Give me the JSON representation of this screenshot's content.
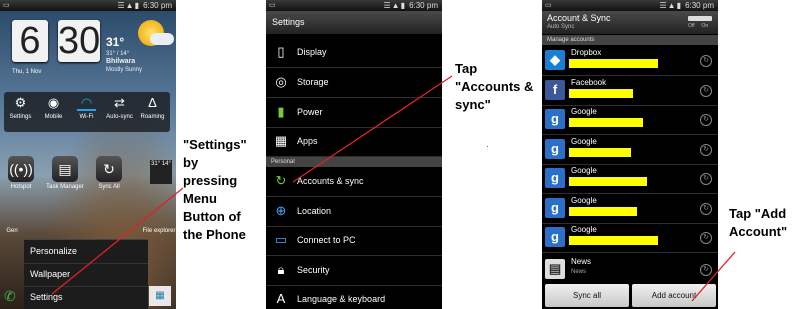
{
  "status_time": "6:30",
  "status_time_suffix": "pm",
  "phone1": {
    "clock_hour": "6",
    "clock_minute": "30",
    "temperature": "31°",
    "temp_range": "31° / 14°",
    "city": "Bhilwara",
    "condition": "Mostly Sunny",
    "date": "Thu, 1 Nov",
    "toggles": [
      {
        "label": "Settings",
        "icon": "gear-icon"
      },
      {
        "label": "Mobile",
        "icon": "globe-icon"
      },
      {
        "label": "Wi-Fi",
        "icon": "wifi-icon"
      },
      {
        "label": "Auto-sync",
        "icon": "sync-icon"
      },
      {
        "label": "Roaming",
        "icon": "roaming-icon"
      }
    ],
    "apps": [
      {
        "label": "Hotspot",
        "icon": "hotspot-icon"
      },
      {
        "label": "Task Manager",
        "icon": "task-manager-icon"
      },
      {
        "label": "Sync All",
        "icon": "sync-all-icon"
      }
    ],
    "weather_badge": "31° 14°",
    "popup_menu": [
      "Personalize",
      "Wallpaper",
      "Settings"
    ],
    "bottom_labels": [
      "Gen",
      "File explorer"
    ]
  },
  "phone2": {
    "title": "Settings",
    "items": [
      {
        "label": "Display",
        "icon": "display-icon"
      },
      {
        "label": "Storage",
        "icon": "storage-icon"
      },
      {
        "label": "Power",
        "icon": "battery-icon"
      },
      {
        "label": "Apps",
        "icon": "apps-icon"
      }
    ],
    "section": "Personal",
    "personal_items": [
      {
        "label": "Accounts & sync",
        "icon": "sync-icon"
      },
      {
        "label": "Location",
        "icon": "location-icon"
      },
      {
        "label": "Connect to PC",
        "icon": "pc-icon"
      },
      {
        "label": "Security",
        "icon": "lock-icon"
      },
      {
        "label": "Language & keyboard",
        "icon": "keyboard-icon"
      }
    ]
  },
  "phone3": {
    "title": "Account & Sync",
    "subtitle": "Auto Sync",
    "toggle_off": "Off",
    "toggle_on": "On",
    "section": "Manage accounts",
    "accounts": [
      {
        "name": "Dropbox",
        "icon": "dropbox-icon",
        "color": "#1a7fd4",
        "redact_fraction": 0.71
      },
      {
        "name": "Facebook",
        "icon": "facebook-icon",
        "color": "#3b5998",
        "redact_fraction": 0.51
      },
      {
        "name": "Google",
        "icon": "google-icon",
        "color": "#2a6fc8",
        "redact_fraction": 0.59
      },
      {
        "name": "Google",
        "icon": "google-icon",
        "color": "#2a6fc8",
        "redact_fraction": 0.49
      },
      {
        "name": "Google",
        "icon": "google-icon",
        "color": "#2a6fc8",
        "redact_fraction": 0.62
      },
      {
        "name": "Google",
        "icon": "google-icon",
        "color": "#2a6fc8",
        "redact_fraction": 0.54
      },
      {
        "name": "Google",
        "icon": "google-icon",
        "color": "#2a6fc8",
        "redact_fraction": 0.71
      }
    ],
    "news_name": "News",
    "news_sub": "News",
    "sync_all": "Sync all",
    "add_account": "Add account"
  },
  "annotations": {
    "settings_lines": [
      "\"Settings\"",
      "by",
      "pressing",
      "Menu",
      "Button of",
      "the Phone"
    ],
    "accounts_lines": [
      "Tap",
      "\"Accounts &",
      "sync\""
    ],
    "add_lines": [
      "Tap \"Add",
      "Account\""
    ]
  },
  "colors": {
    "arrow": "#e0202a",
    "redaction": "#ffff00",
    "wifi_active": "#1fa5f0"
  }
}
